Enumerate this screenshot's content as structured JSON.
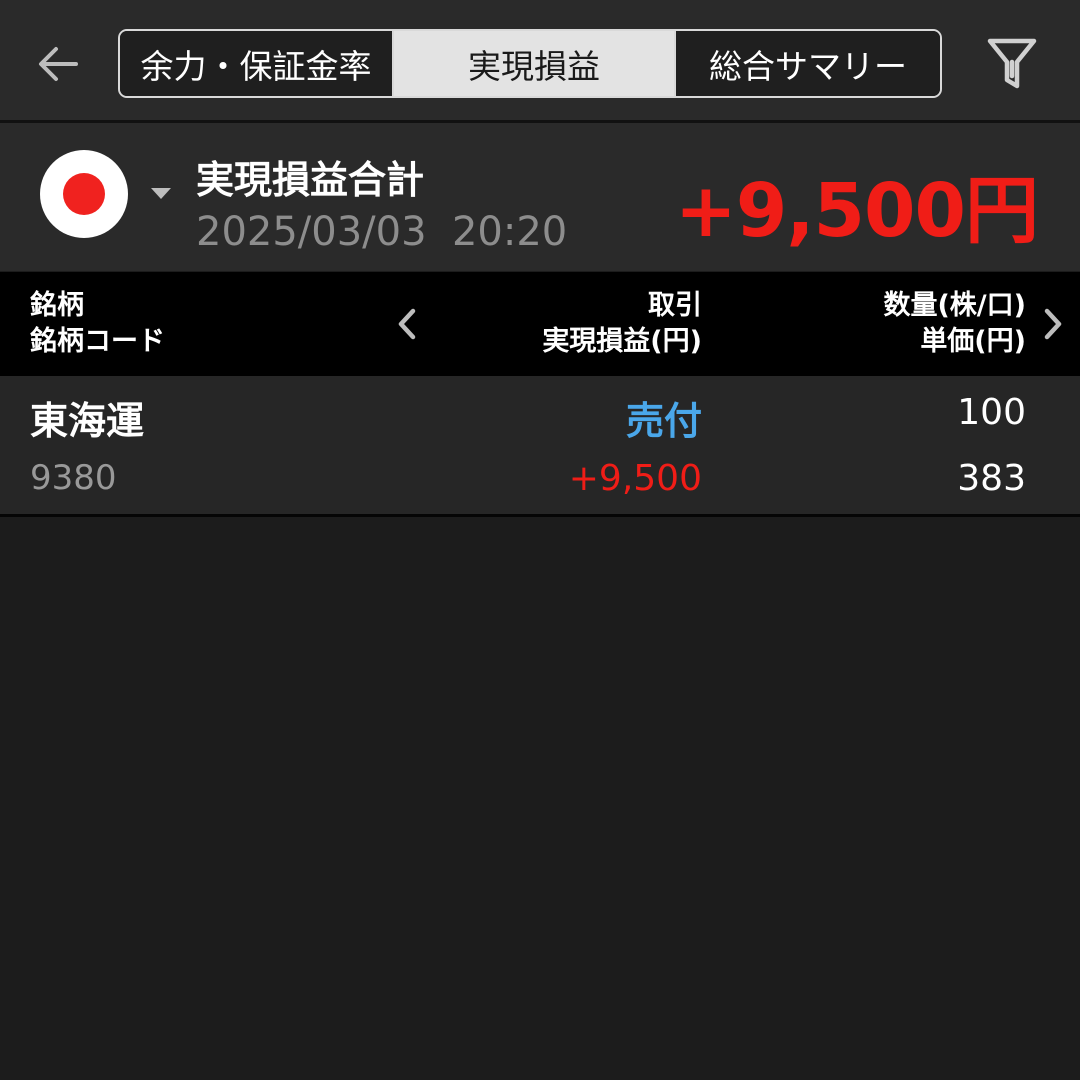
{
  "header": {
    "tabs": [
      {
        "label": "余力・保証金率",
        "selected": false
      },
      {
        "label": "実現損益",
        "selected": true
      },
      {
        "label": "総合サマリー",
        "selected": false
      }
    ],
    "back_icon": "arrow-left-icon",
    "filter_icon": "filter-icon"
  },
  "summary": {
    "market_icon": "japan-flag-icon",
    "title": "実現損益合計",
    "datetime": "2025/03/03  20:20",
    "total": "+9,500円"
  },
  "table": {
    "col1": {
      "line1": "銘柄",
      "line2": "銘柄コード"
    },
    "col2": {
      "line1": "取引",
      "line2": "実現損益(円)"
    },
    "col3": {
      "line1": "数量(株/口)",
      "line2": "単価(円)"
    },
    "rows": [
      {
        "name": "東海運",
        "code": "9380",
        "trade": "売付",
        "pnl": "+9,500",
        "qty": "100",
        "price": "383"
      }
    ]
  },
  "colors": {
    "profit": "#f01d17",
    "sell": "#4aa7ea",
    "background": "#1c1c1c"
  }
}
